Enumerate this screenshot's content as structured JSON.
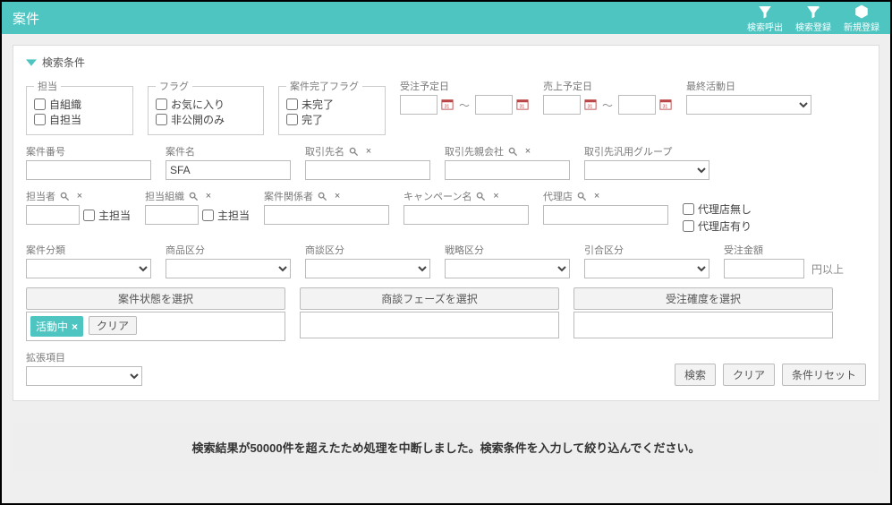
{
  "header": {
    "title": "案件",
    "actions": {
      "recall": "検索呼出",
      "save_search": "検索登録",
      "new": "新規登録"
    }
  },
  "panel": {
    "title": "検索条件"
  },
  "groups": {
    "assignee": {
      "legend": "担当",
      "own_org": "自組織",
      "own_assign": "自担当"
    },
    "flag": {
      "legend": "フラグ",
      "favorite": "お気に入り",
      "private_only": "非公開のみ"
    },
    "complete": {
      "legend": "案件完了フラグ",
      "incomplete": "未完了",
      "complete": "完了"
    }
  },
  "dates": {
    "order": "受注予定日",
    "sales": "売上予定日",
    "tilde": "〜"
  },
  "last_activity": "最終活動日",
  "labels": {
    "case_no": "案件番号",
    "case_name": "案件名",
    "account_name": "取引先名",
    "parent_account": "取引先親会社",
    "account_group": "取引先汎用グループ",
    "assignee": "担当者",
    "assignee_org": "担当組織",
    "related": "案件関係者",
    "campaign": "キャンペーン名",
    "agency": "代理店",
    "main_assign": "主担当",
    "agency_none": "代理店無し",
    "agency_yes": "代理店有り",
    "case_class": "案件分類",
    "product_class": "商品区分",
    "nego_class": "商談区分",
    "strategy_class": "戦略区分",
    "compete_class": "引合区分",
    "order_amount": "受注金額",
    "amount_suffix": "円以上",
    "ext_items": "拡張項目"
  },
  "values": {
    "case_name": "SFA"
  },
  "buttons": {
    "select_status": "案件状態を選択",
    "select_phase": "商談フェーズを選択",
    "select_prob": "受注確度を選択",
    "search": "検索",
    "clear": "クリア",
    "reset": "条件リセット"
  },
  "tags": {
    "active": "活動中",
    "clear_tag": "クリア"
  },
  "result_message": "検索結果が50000件を超えたため処理を中断しました。検索条件を入力して絞り込んでください。"
}
